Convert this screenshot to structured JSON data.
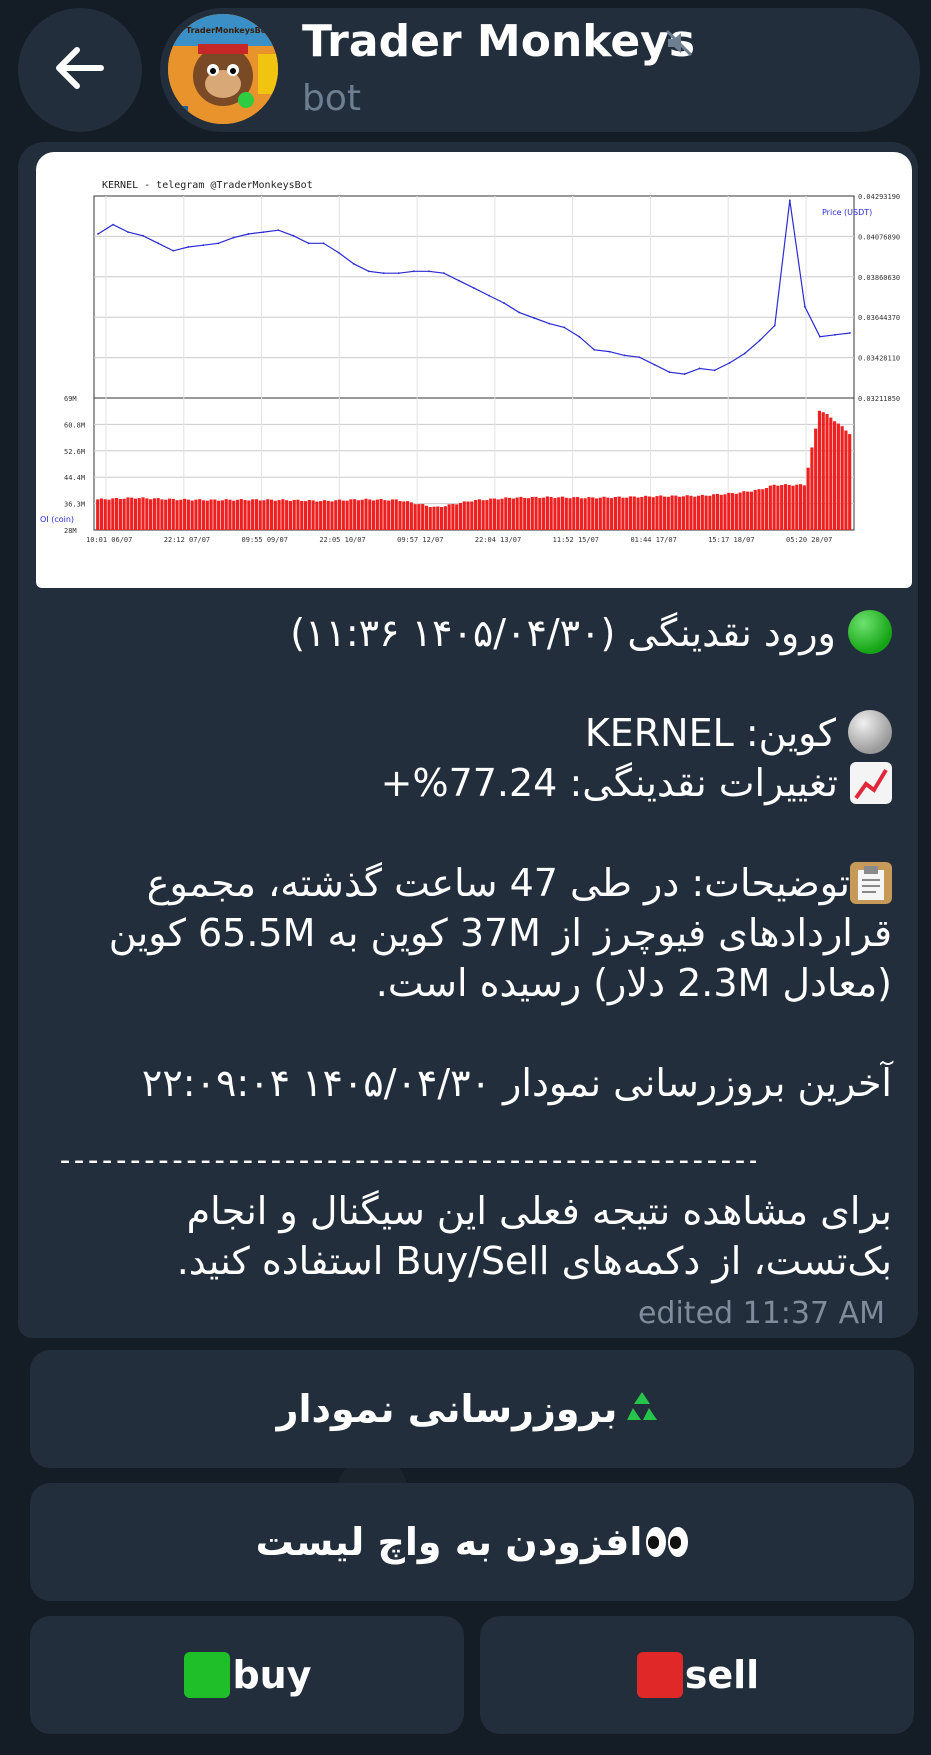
{
  "header": {
    "title": "Trader Monkeys",
    "subtitle": "bot",
    "avatar_text": "TraderMonkeysBot"
  },
  "chart_data": {
    "type": "line",
    "title": "KERNEL - telegram @TraderMonkeysBot",
    "ylabel_right": "Price (USDT)",
    "ylabel_left_lower": "OI (coin)",
    "price_ticks": [
      "0.04293190",
      "0.04076890",
      "0.03860630",
      "0.03644370",
      "0.03428110",
      "0.03211850"
    ],
    "oi_ticks": [
      "69M",
      "60.8M",
      "52.6M",
      "44.4M",
      "36.3M",
      "28M"
    ],
    "x_ticks": [
      "10:01 06/07",
      "22:12 07/07",
      "09:55 09/07",
      "22:05 10/07",
      "09:57 12/07",
      "22:04 13/07",
      "11:52 15/07",
      "01:44 17/07",
      "15:17 18/07",
      "05:20 20/07"
    ],
    "price_range": [
      0.0321185,
      0.0429319
    ],
    "oi_range": [
      28,
      69
    ],
    "series": [
      {
        "name": "Price (USDT)",
        "x": [
          0,
          2,
          4,
          6,
          8,
          10,
          12,
          14,
          16,
          18,
          20,
          22,
          24,
          26,
          28,
          30,
          32,
          34,
          36,
          38,
          40,
          42,
          44,
          46,
          48,
          50,
          52,
          54,
          56,
          58,
          60,
          62,
          64,
          66,
          68,
          70,
          72,
          74,
          76,
          78,
          80,
          82,
          84,
          86,
          88,
          90,
          92,
          94,
          96,
          98,
          100
        ],
        "values": [
          0.0409,
          0.0414,
          0.041,
          0.0408,
          0.0404,
          0.04,
          0.0402,
          0.0403,
          0.0404,
          0.0407,
          0.0409,
          0.041,
          0.0411,
          0.0408,
          0.0404,
          0.0404,
          0.0399,
          0.0393,
          0.0389,
          0.0388,
          0.0388,
          0.0389,
          0.0389,
          0.0388,
          0.0384,
          0.038,
          0.0376,
          0.0372,
          0.0367,
          0.0364,
          0.0361,
          0.0359,
          0.0354,
          0.0347,
          0.0346,
          0.0344,
          0.0343,
          0.0339,
          0.0335,
          0.0334,
          0.0337,
          0.0336,
          0.034,
          0.0345,
          0.0352,
          0.036,
          0.0427,
          0.037,
          0.0354,
          0.0355,
          0.0356
        ]
      },
      {
        "name": "OI (coin)",
        "x": [
          0,
          5,
          10,
          15,
          20,
          25,
          30,
          35,
          40,
          45,
          50,
          55,
          60,
          65,
          70,
          75,
          80,
          85,
          88,
          90,
          92,
          94,
          96,
          98,
          100
        ],
        "values": [
          37.5,
          38,
          37.5,
          37.3,
          37.4,
          37.3,
          37,
          37.5,
          37.3,
          35,
          37.2,
          38,
          38.2,
          38,
          38.2,
          38.5,
          38.6,
          39.5,
          40.5,
          42,
          42,
          42,
          65.5,
          62,
          58
        ]
      }
    ]
  },
  "message": {
    "headline_emoji": "green-circle",
    "headline": "ورود نقدینگی (۱۴۰۵/۰۴/۳۰ ۱۱:۳۶)",
    "coin_line": "کوین: KERNEL",
    "change_line": "تغییرات نقدینگی: 77.24%+",
    "description": "توضیحات: در طی 47 ساعت گذشته، مجموع قراردادهای فیوچرز از 37M کوین به 65.5M کوین (معادل 2.3M دلار) رسیده است.",
    "last_update": "آخرین بروزرسانی نمودار ۱۴۰۵/۰۴/۳۰ ۲۲:۰۹:۰۴",
    "divider": "----------------------------------------------------",
    "backtest_note": "برای مشاهده نتیجه فعلی این سیگنال و انجام بک‌تست، از دکمه‌های Buy/Sell استفاده کنید.",
    "edited_time": "edited 11:37 AM"
  },
  "buttons": {
    "refresh_chart": "بروزرسانی نمودار",
    "add_watchlist": "افزودن به واچ لیست",
    "buy": "buy",
    "sell": "sell"
  },
  "colors": {
    "background": "#141c26",
    "bubble": "#222e3b",
    "price_line": "#2b2bd4",
    "oi_bars": "#ee2020",
    "buy_square": "#1fbf2a",
    "sell_square": "#e02828"
  }
}
